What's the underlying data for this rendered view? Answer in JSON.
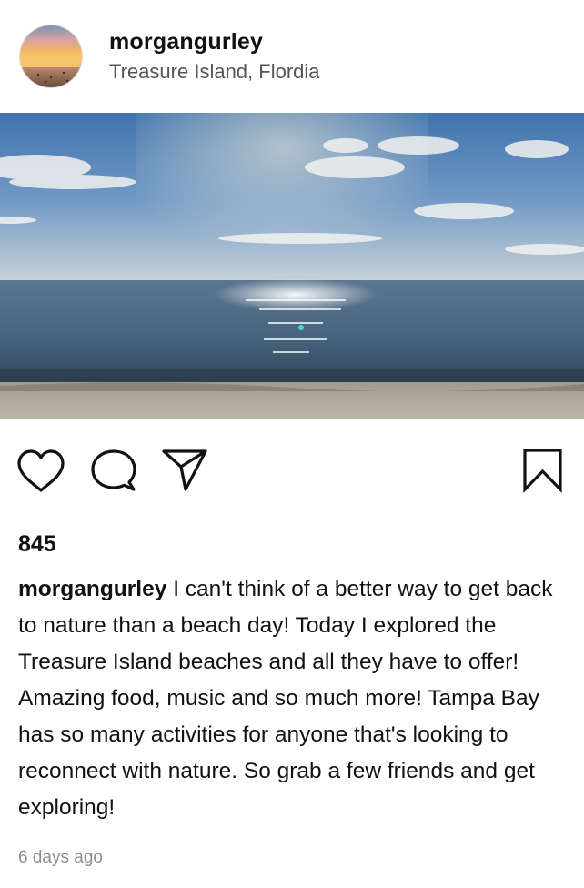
{
  "post": {
    "username": "morgangurley",
    "location": "Treasure Island, Flordia",
    "likes": "845",
    "caption_user": "morgangurley",
    "caption_text": "I can't think of a better way to get back to nature than a beach day! Today I explored the Treasure Island beaches and all they have to offer! Amazing food, music and so much more! Tampa Bay has so many activities for anyone that's looking to reconnect with nature. So grab a few friends and get exploring!",
    "timestamp": "6 days ago"
  },
  "actions": {
    "like_icon": "heart-icon",
    "comment_icon": "comment-bubble-icon",
    "share_icon": "paper-plane-icon",
    "save_icon": "bookmark-icon"
  },
  "colors": {
    "text": "#111111",
    "secondary": "#555555",
    "muted": "#8e8e8e"
  }
}
